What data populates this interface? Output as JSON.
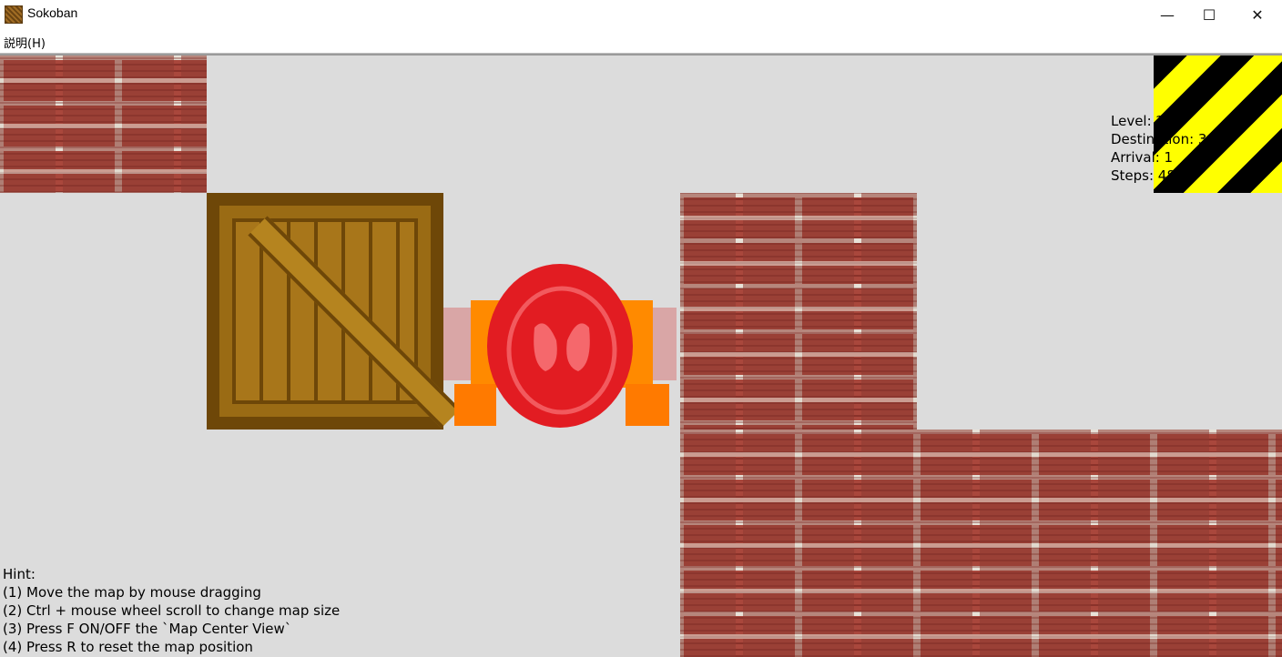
{
  "window": {
    "title": "Sokoban",
    "minimize_glyph": "—",
    "maximize_glyph": "☐",
    "close_glyph": "✕"
  },
  "menu": {
    "help_label": "説明(H)"
  },
  "stats": {
    "level": "Level: 2",
    "destination": "Destination: 3",
    "arrival": "Arrival: 1",
    "steps": "Steps: 48"
  },
  "hint": {
    "title": "Hint:",
    "lines": [
      "(1) Move the map by mouse dragging",
      "(2) Ctrl + mouse wheel scroll to change map size",
      "(3) Press F ON/OFF the `Map Center View`",
      "(4) Press R to reset the map position"
    ]
  },
  "tiles": {
    "wall_color": "#a9473c",
    "floor_color": "#dcdcdc",
    "crate_color": "#9a6b14",
    "player_color": "#e02020",
    "hazard_colors": [
      "#000000",
      "#ffff00"
    ]
  }
}
